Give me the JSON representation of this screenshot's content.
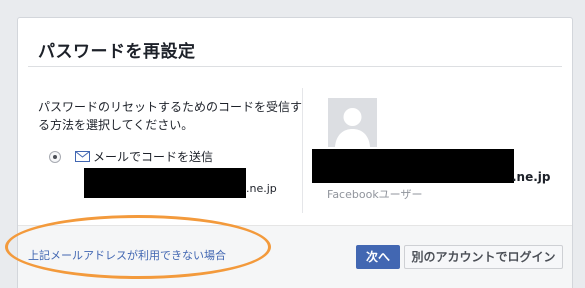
{
  "dialog": {
    "title": "パスワードを再設定",
    "instructions": "パスワードのリセットするためのコードを受信する方法を選択してください。",
    "option_label": "メールでコードを送信",
    "email_left_suffix": ".ne.jp",
    "email_right_suffix": ".ne.jp",
    "account_type": "Facebookユーザー"
  },
  "footer": {
    "link_label": "上記メールアドレスが利用できない場合",
    "next_label": "次へ",
    "login_label": "別のアカウントでログイン"
  },
  "colors": {
    "brand": "#4267b2",
    "highlight": "#f39a3c"
  },
  "icons": [
    "radio-selected-icon",
    "mail-icon",
    "default-avatar-icon"
  ]
}
